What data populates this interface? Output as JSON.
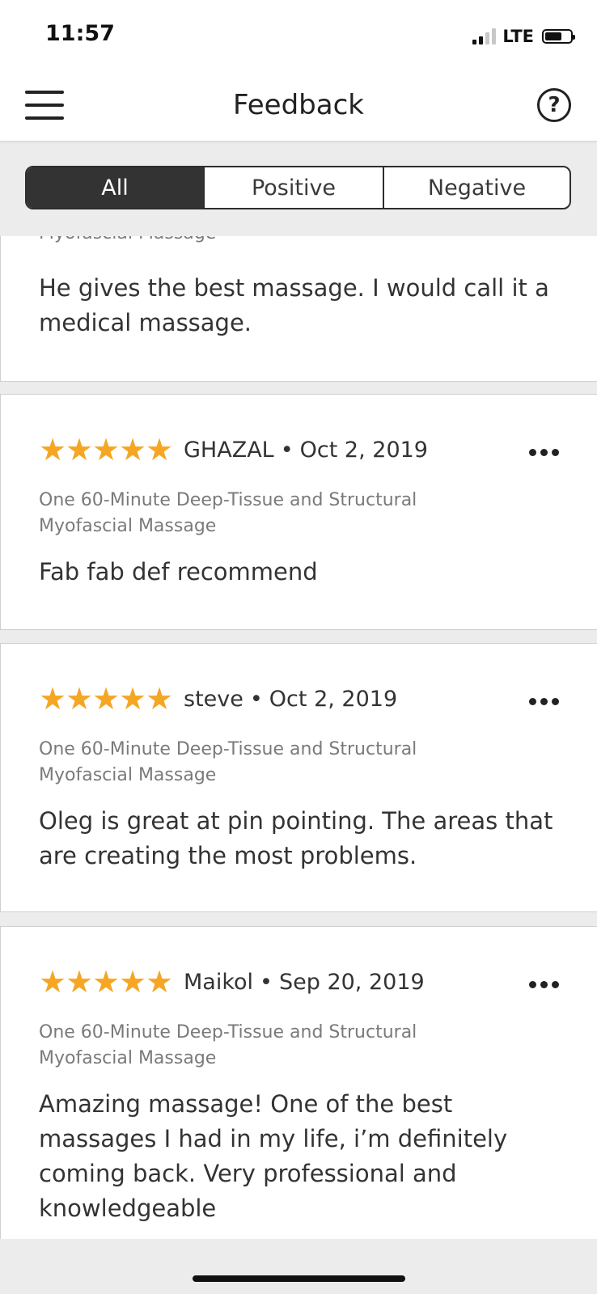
{
  "status_bar": {
    "time": "11:57",
    "network": "LTE"
  },
  "header": {
    "title": "Feedback"
  },
  "filter_tabs": [
    {
      "label": "All",
      "active": true
    },
    {
      "label": "Positive",
      "active": false
    },
    {
      "label": "Negative",
      "active": false
    }
  ],
  "reviews": [
    {
      "service": "Myofascial Massage",
      "text": "He gives the best massage. I would call it a medical massage."
    },
    {
      "rating": 5,
      "name": "GHAZAL",
      "date": "Oct 2, 2019",
      "service": "One 60-Minute Deep-Tissue and Structural Myofascial Massage",
      "text": "Fab fab def recommend"
    },
    {
      "rating": 5,
      "name": "steve",
      "date": "Oct 2, 2019",
      "service": "One 60-Minute Deep-Tissue and Structural Myofascial Massage",
      "text": "Oleg is great at pin pointing. The areas that are creating the most problems."
    },
    {
      "rating": 5,
      "name": "Maikol",
      "date": "Sep 20, 2019",
      "service": "One 60-Minute Deep-Tissue and Structural Myofascial Massage",
      "text": "Amazing massage!  One of the best massages I had in my life, i’m definitely coming back. Very professional and knowledgeable"
    }
  ],
  "colors": {
    "star": "#f5a623",
    "active_tab": "#333333"
  },
  "icons": [
    "hamburger-menu-icon",
    "help-question-icon",
    "more-options-icon",
    "star-icon"
  ]
}
